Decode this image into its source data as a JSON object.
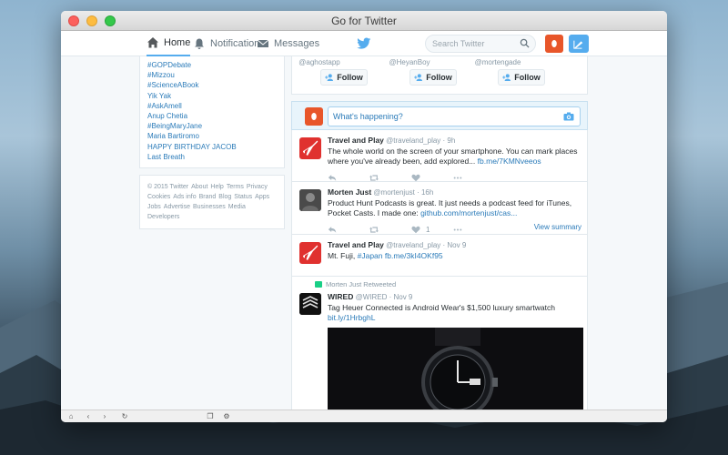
{
  "window": {
    "title": "Go for Twitter"
  },
  "nav": {
    "home": "Home",
    "notifications": "Notifications",
    "messages": "Messages",
    "search_placeholder": "Search Twitter"
  },
  "trends": [
    "#GOPDebate",
    "#Mizzou",
    "#ScienceABook",
    "Yik Yak",
    "#AskAmell",
    "Anup Chetia",
    "#BeingMaryJane",
    "Maria Bartiromo",
    "HAPPY BIRTHDAY JACOB",
    "Last Breath"
  ],
  "footer": {
    "line1": [
      "© 2015 Twitter",
      "About",
      "Help",
      "Terms",
      "Privacy"
    ],
    "line2": [
      "Cookies",
      "Ads info",
      "Brand",
      "Blog",
      "Status",
      "Apps"
    ],
    "line3": [
      "Jobs",
      "Advertise",
      "Businesses",
      "Media"
    ],
    "line4": [
      "Developers"
    ]
  },
  "who_to_follow": [
    {
      "handle": "@aghostapp",
      "button": "Follow"
    },
    {
      "handle": "@HeyanBoy",
      "button": "Follow"
    },
    {
      "handle": "@mortengade",
      "button": "Follow"
    }
  ],
  "compose": {
    "placeholder": "What's happening?"
  },
  "tweets": [
    {
      "name": "Travel and Play",
      "meta": "@traveland_play · 9h",
      "text": "The whole world on the screen of your smartphone. You can mark places where you've already been, add explored...",
      "link": "fb.me/7KMNveeos",
      "likes": ""
    },
    {
      "name": "Morten Just",
      "meta": "@mortenjust · 16h",
      "text": "Product Hunt Podcasts is great. It just needs a podcast feed for iTunes, Pocket Casts. I made one:",
      "link": "github.com/mortenjust/cas...",
      "likes": "1",
      "view_summary": "View summary"
    },
    {
      "name": "Travel and Play",
      "meta": "@traveland_play · Nov 9",
      "text": "Mt. Fuji,",
      "hashtag": "#Japan",
      "link": "fb.me/3kI4OKf95"
    },
    {
      "retweeted_by": "Morten Just Retweeted",
      "name": "WIRED",
      "meta": "@WIRED · Nov 9",
      "text": "Tag Heuer Connected is Android Wear's $1,500 luxury smartwatch",
      "link": "bit.ly/1HrbghL"
    }
  ],
  "colors": {
    "twitter_blue": "#55acee",
    "link": "#2b7bb9",
    "app_orange": "#e8562a",
    "travel_red": "#e0312f"
  }
}
